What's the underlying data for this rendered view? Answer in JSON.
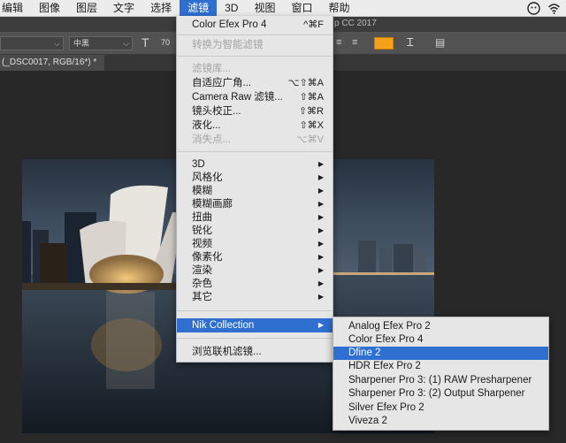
{
  "menubar": {
    "items": [
      "编辑",
      "图像",
      "图层",
      "文字",
      "选择",
      "滤镜",
      "3D",
      "视图",
      "窗口",
      "帮助"
    ],
    "active_index": 5
  },
  "app_title": "p CC 2017",
  "options_bar": {
    "font_style": "中黑",
    "font_size": "70",
    "accent_color": "#f5a11a"
  },
  "document_tab": "(_DSC0017, RGB/16*) *",
  "filter_menu": {
    "last_filter": {
      "label": "Color Efex Pro 4",
      "shortcut": "^⌘F"
    },
    "convert_smart": "转换为智能滤镜",
    "gallery": "滤镜库...",
    "adaptive_wide": {
      "label": "自适应广角...",
      "shortcut": "⌥⇧⌘A"
    },
    "camera_raw": {
      "label": "Camera Raw 滤镜...",
      "shortcut": "⇧⌘A"
    },
    "lens_correction": {
      "label": "镜头校正...",
      "shortcut": "⇧⌘R"
    },
    "liquify": {
      "label": "液化...",
      "shortcut": "⇧⌘X"
    },
    "vanishing_point": {
      "label": "消失点...",
      "shortcut": "⌥⌘V"
    },
    "submenus": [
      "3D",
      "风格化",
      "模糊",
      "模糊画廊",
      "扭曲",
      "锐化",
      "视频",
      "像素化",
      "渲染",
      "杂色",
      "其它"
    ],
    "nik_collection": "Nik Collection",
    "browse_online": "浏览联机滤镜..."
  },
  "nik_submenu": {
    "items": [
      "Analog Efex Pro 2",
      "Color Efex Pro 4",
      "Dfine 2",
      "HDR Efex Pro 2",
      "Sharpener Pro 3: (1) RAW Presharpener",
      "Sharpener Pro 3: (2) Output Sharpener",
      "Silver Efex Pro 2",
      "Viveza 2"
    ],
    "highlight_index": 2
  },
  "colors": {
    "highlight": "#2f6fd0",
    "menu_bg": "#e6e6e6"
  }
}
